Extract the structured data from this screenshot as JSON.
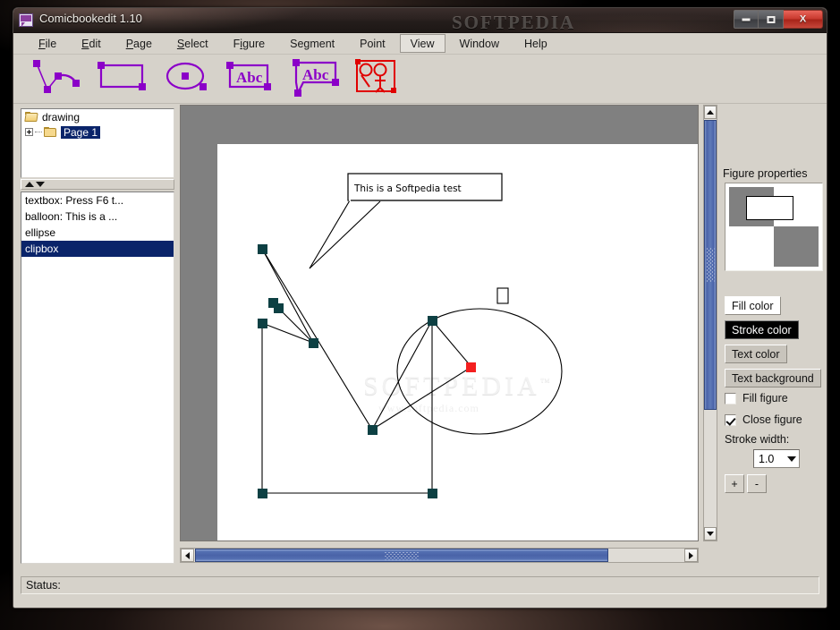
{
  "window": {
    "title": "Comicbookedit 1.10",
    "watermark": "SOFTPEDIA",
    "app_icon": "comic-balloon-icon",
    "buttons": {
      "minimize": "minimize-icon",
      "maximize": "maximize-icon",
      "close": "X"
    }
  },
  "menu": {
    "items": [
      {
        "label": "File",
        "mnemonic": "F",
        "active": false
      },
      {
        "label": "Edit",
        "mnemonic": "E",
        "active": false
      },
      {
        "label": "Page",
        "mnemonic": "P",
        "active": false
      },
      {
        "label": "Select",
        "mnemonic": "S",
        "active": false
      },
      {
        "label": "Figure",
        "mnemonic": "i",
        "active": false
      },
      {
        "label": "Segment",
        "mnemonic": "S",
        "active": false
      },
      {
        "label": "Point",
        "mnemonic": "P",
        "active": false
      },
      {
        "label": "View",
        "mnemonic": "V",
        "active": true
      },
      {
        "label": "Window",
        "mnemonic": "W",
        "active": false
      },
      {
        "label": "Help",
        "mnemonic": "H",
        "active": false
      }
    ]
  },
  "toolbar": {
    "items": [
      {
        "name": "polyline-tool",
        "title": "Polyline",
        "color": "#8B00C8"
      },
      {
        "name": "rectangle-tool",
        "title": "Rectangle",
        "color": "#8B00C8"
      },
      {
        "name": "ellipse-tool",
        "title": "Ellipse",
        "color": "#8B00C8"
      },
      {
        "name": "textbox-tool",
        "title": "Abc",
        "color": "#8B00C8"
      },
      {
        "name": "balloon-tool",
        "title": "Abc",
        "color": "#8B00C8"
      },
      {
        "name": "figures-tool",
        "title": "Figures",
        "color": "#E00000"
      }
    ],
    "text_glyph": "Abc"
  },
  "tree": {
    "root": {
      "label": "drawing",
      "icon": "folder-open-icon"
    },
    "child": {
      "label": "Page 1",
      "icon": "folder-icon",
      "selected": true,
      "expander": "plus-icon"
    }
  },
  "object_list": {
    "items": [
      {
        "label": "textbox: Press F6 t...",
        "selected": false
      },
      {
        "label": "balloon: This is a ...",
        "selected": false
      },
      {
        "label": "ellipse",
        "selected": false
      },
      {
        "label": "clipbox",
        "selected": true
      }
    ]
  },
  "canvas": {
    "balloon_text": "This is a Softpedia test",
    "watermark_big": "SOFTPEDIA",
    "watermark_tm": "™",
    "watermark_url": "www.softpedia.com",
    "handle_color": "#0d4043",
    "active_handle_color": "#f41f1f",
    "stroke_color": "#000000",
    "page_color": "#ffffff",
    "surround_color": "#808080"
  },
  "properties": {
    "title": "Figure properties",
    "preview": {
      "checker_color": "#808080",
      "base_color": "#ffffff",
      "rect_fill": "#ffffff",
      "rect_stroke": "#000000"
    },
    "buttons": [
      {
        "name": "fill-color-button",
        "label": "Fill color",
        "bg": "#ffffff",
        "fg": "#111111"
      },
      {
        "name": "stroke-color-button",
        "label": "Stroke color",
        "bg": "#000000",
        "fg": "#ffffff"
      },
      {
        "name": "text-color-button",
        "label": "Text color",
        "bg": "#c8c4bc",
        "fg": "#111111"
      },
      {
        "name": "text-background-button",
        "label": "Text background",
        "bg": "#c8c4bc",
        "fg": "#111111"
      }
    ],
    "checkboxes": [
      {
        "name": "fill-figure-checkbox",
        "label": "Fill figure",
        "checked": false
      },
      {
        "name": "close-figure-checkbox",
        "label": "Close figure",
        "checked": true
      }
    ],
    "stroke_width": {
      "label": "Stroke width:",
      "value": "1.0"
    },
    "increase_label": "+",
    "decrease_label": "-"
  },
  "statusbar": {
    "label": "Status:"
  }
}
